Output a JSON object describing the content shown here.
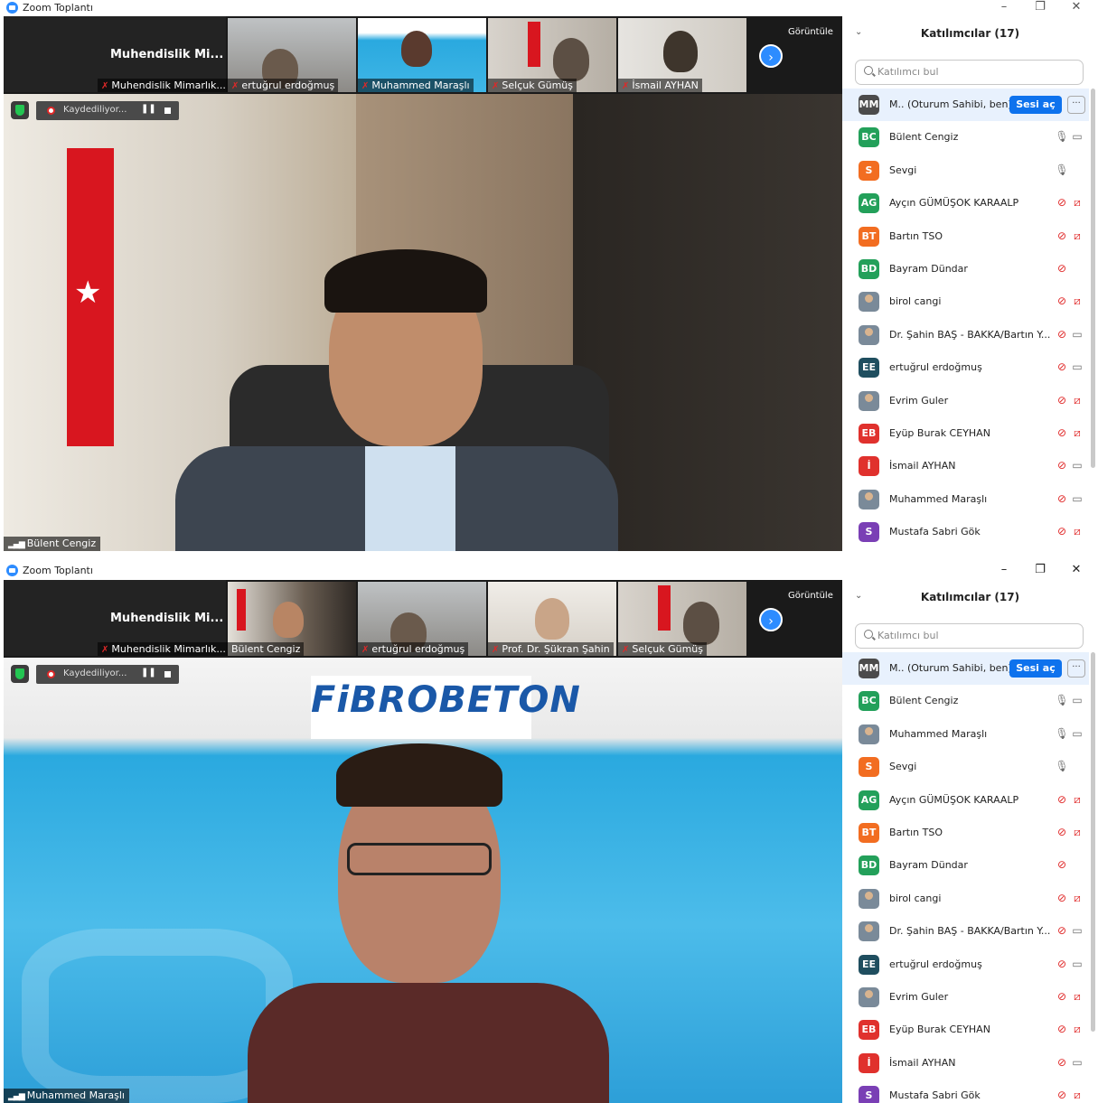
{
  "windows": [
    {
      "app_title": "Zoom Toplantı",
      "meeting_name": "Muhendislik  Mi...",
      "view_label": "Görüntüle",
      "strip_tiles": [
        "Muhendislik Mimarlık...",
        "ertuğrul erdoğmuş",
        "Muhammed Maraşlı",
        "Selçuk Gümüş",
        "İsmail AYHAN"
      ],
      "recording_label": "Kaydediliyor...",
      "speaker_name": "Bülent Cengiz",
      "panel_title": "Katılımcılar (17)",
      "search_placeholder": "Katılımcı bul",
      "host_row": {
        "initials": "MM",
        "name": "M.. (Oturum Sahibi, ben)",
        "unmute": "Sesi aç",
        "more": "···",
        "color": "#4b4b4b"
      },
      "participants": [
        {
          "initials": "BC",
          "name": "Bülent Cengiz",
          "color": "#23a05a",
          "mic": "on",
          "cam": "on"
        },
        {
          "initials": "S",
          "name": "Sevgi",
          "color": "#f26d21",
          "mic": "on",
          "cam": "none"
        },
        {
          "initials": "AG",
          "name": "Ayçın GÜMÜŞOK KARAALP",
          "color": "#23a05a",
          "mic": "off",
          "cam": "off"
        },
        {
          "initials": "BT",
          "name": "Bartın TSO",
          "color": "#f26d21",
          "mic": "off",
          "cam": "off"
        },
        {
          "initials": "BD",
          "name": "Bayram Dündar",
          "color": "#23a05a",
          "mic": "off",
          "cam": "none"
        },
        {
          "initials": "",
          "name": "birol cangi",
          "color": "photo",
          "mic": "off",
          "cam": "off"
        },
        {
          "initials": "",
          "name": "Dr. Şahin BAŞ - BAKKA/Bartın Y...",
          "color": "photo",
          "mic": "off",
          "cam": "on"
        },
        {
          "initials": "EE",
          "name": "ertuğrul erdoğmuş",
          "color": "#1f4e5f",
          "mic": "off",
          "cam": "on"
        },
        {
          "initials": "",
          "name": "Evrim Guler",
          "color": "photo",
          "mic": "off",
          "cam": "off"
        },
        {
          "initials": "EB",
          "name": "Eyüp Burak CEYHAN",
          "color": "#e0312d",
          "mic": "off",
          "cam": "off"
        },
        {
          "initials": "İ",
          "name": "İsmail AYHAN",
          "color": "#e0312d",
          "mic": "off",
          "cam": "on"
        },
        {
          "initials": "",
          "name": "Muhammed Maraşlı",
          "color": "photo",
          "mic": "off",
          "cam": "on"
        },
        {
          "initials": "S",
          "name": "Mustafa Sabri Gök",
          "color": "#7a3fb5",
          "mic": "off",
          "cam": "off"
        }
      ]
    },
    {
      "app_title": "Zoom Toplantı",
      "meeting_name": "Muhendislik  Mi...",
      "view_label": "Görüntüle",
      "strip_tiles": [
        "Muhendislik Mimarlık...",
        "Bülent Cengiz",
        "ertuğrul erdoğmuş",
        "Prof. Dr. Şükran Şahin",
        "Selçuk Gümüş"
      ],
      "recording_label": "Kaydediliyor...",
      "speaker_name": "Muhammed Maraşlı",
      "brand_text": "FiBROBETON",
      "panel_title": "Katılımcılar (17)",
      "search_placeholder": "Katılımcı bul",
      "host_row": {
        "initials": "MM",
        "name": "M.. (Oturum Sahibi, ben)",
        "unmute": "Sesi aç",
        "more": "···",
        "color": "#4b4b4b"
      },
      "participants": [
        {
          "initials": "BC",
          "name": "Bülent Cengiz",
          "color": "#23a05a",
          "mic": "on",
          "cam": "on"
        },
        {
          "initials": "",
          "name": "Muhammed Maraşlı",
          "color": "photo",
          "mic": "on",
          "cam": "on"
        },
        {
          "initials": "S",
          "name": "Sevgi",
          "color": "#f26d21",
          "mic": "on",
          "cam": "none"
        },
        {
          "initials": "AG",
          "name": "Ayçın GÜMÜŞOK KARAALP",
          "color": "#23a05a",
          "mic": "off",
          "cam": "off"
        },
        {
          "initials": "BT",
          "name": "Bartın TSO",
          "color": "#f26d21",
          "mic": "off",
          "cam": "off"
        },
        {
          "initials": "BD",
          "name": "Bayram Dündar",
          "color": "#23a05a",
          "mic": "off",
          "cam": "none"
        },
        {
          "initials": "",
          "name": "birol cangi",
          "color": "photo",
          "mic": "off",
          "cam": "off"
        },
        {
          "initials": "",
          "name": "Dr. Şahin BAŞ - BAKKA/Bartın Y...",
          "color": "photo",
          "mic": "off",
          "cam": "on"
        },
        {
          "initials": "EE",
          "name": "ertuğrul erdoğmuş",
          "color": "#1f4e5f",
          "mic": "off",
          "cam": "on"
        },
        {
          "initials": "",
          "name": "Evrim Guler",
          "color": "photo",
          "mic": "off",
          "cam": "off"
        },
        {
          "initials": "EB",
          "name": "Eyüp Burak CEYHAN",
          "color": "#e0312d",
          "mic": "off",
          "cam": "off"
        },
        {
          "initials": "İ",
          "name": "İsmail AYHAN",
          "color": "#e0312d",
          "mic": "off",
          "cam": "on"
        },
        {
          "initials": "S",
          "name": "Mustafa Sabri Gök",
          "color": "#7a3fb5",
          "mic": "off",
          "cam": "off"
        }
      ]
    }
  ]
}
